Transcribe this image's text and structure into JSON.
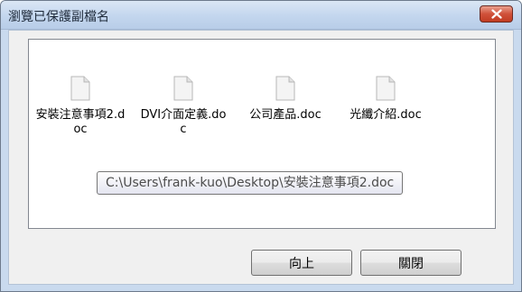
{
  "window": {
    "title": "瀏覽已保護副檔名"
  },
  "files": [
    {
      "name": "安裝注意事項2.doc",
      "icon": "document-icon"
    },
    {
      "name": "DVI介面定義.doc",
      "icon": "document-icon"
    },
    {
      "name": "公司產品.doc",
      "icon": "document-icon"
    },
    {
      "name": "光纖介紹.doc",
      "icon": "document-icon"
    }
  ],
  "tooltip": {
    "text": "C:\\Users\\frank-kuo\\Desktop\\安裝注意事項2.doc"
  },
  "buttons": {
    "up_label": "向上",
    "close_label": "關閉"
  },
  "colors": {
    "titlebar": "#c3d6ee",
    "close_button": "#c94a31",
    "dialog_background": "#f0f0f0"
  }
}
